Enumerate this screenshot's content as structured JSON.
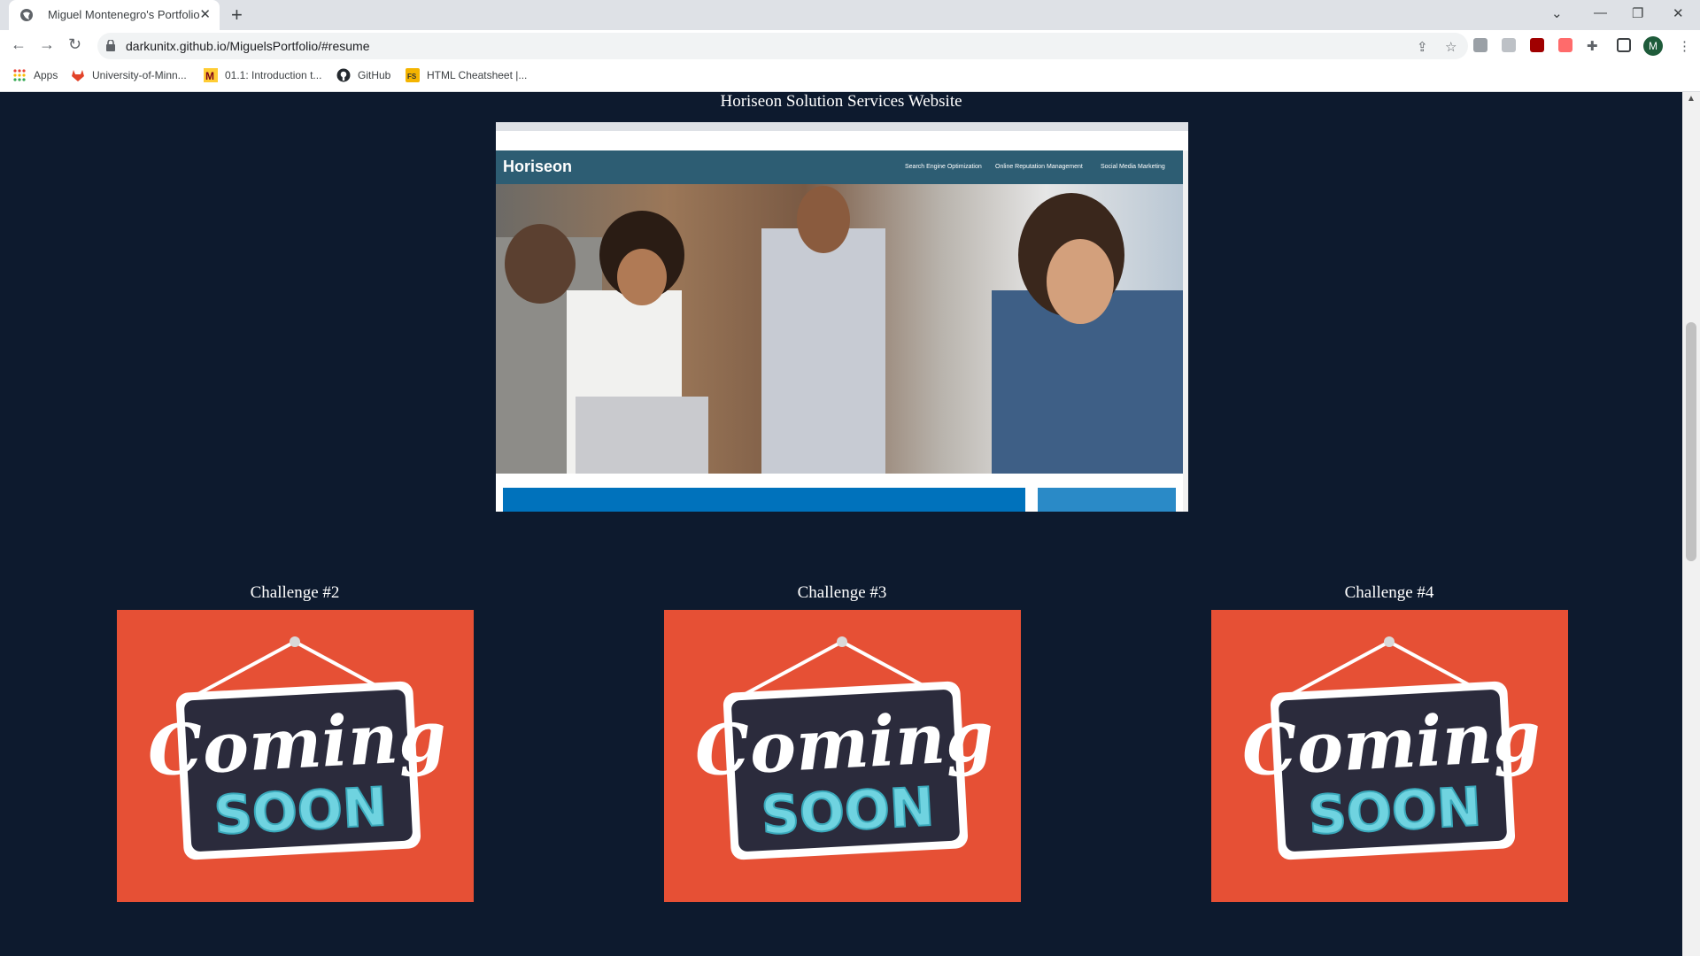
{
  "browser": {
    "tab_title": "Miguel Montenegro's Portfolio",
    "tab_close": "✕",
    "new_tab": "+",
    "url": "darkunitx.github.io/MiguelsPortfolio/#resume",
    "avatar_letter": "M",
    "bookmarks": [
      {
        "label": "Apps",
        "icon": "apps-grid-icon"
      },
      {
        "label": "University-of-Minn...",
        "icon": "gitlab-icon"
      },
      {
        "label": "01.1: Introduction t...",
        "icon": "umn-icon"
      },
      {
        "label": "GitHub",
        "icon": "github-icon"
      },
      {
        "label": "HTML Cheatsheet |...",
        "icon": "cheatsheet-icon"
      }
    ]
  },
  "featured": {
    "title": "Horiseon Solution Services Website",
    "screenshot": {
      "logo": "Horiseon",
      "nav": [
        "Search Engine Optimization",
        "Online Reputation Management",
        "Social Media Marketing"
      ]
    }
  },
  "challenges": [
    {
      "title": "Challenge #2",
      "image_top": "Coming",
      "image_bottom": "SOON"
    },
    {
      "title": "Challenge #3",
      "image_top": "Coming",
      "image_bottom": "SOON"
    },
    {
      "title": "Challenge #4",
      "image_top": "Coming",
      "image_bottom": "SOON"
    }
  ],
  "colors": {
    "page_bg": "#0d1a2e",
    "card_bg": "#e65035",
    "sign_bg": "#2b2b3c",
    "sign_text_top": "#ffffff",
    "sign_text_bottom": "#6fd3e0"
  }
}
